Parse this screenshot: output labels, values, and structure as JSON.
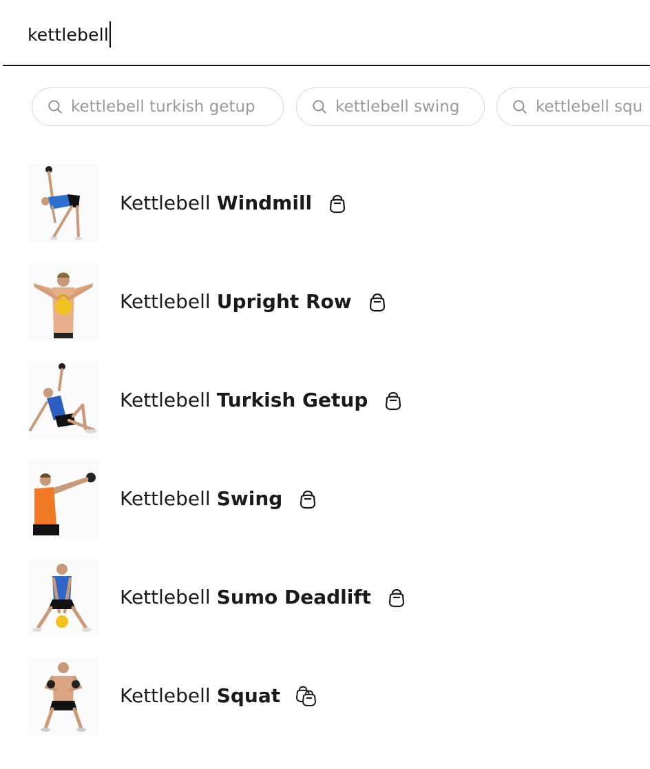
{
  "search": {
    "query": "kettlebell"
  },
  "suggestions": [
    {
      "label": "kettlebell turkish getup",
      "icon": "search-icon"
    },
    {
      "label": "kettlebell swing",
      "icon": "search-icon"
    },
    {
      "label": "kettlebell squ",
      "icon": "search-icon"
    }
  ],
  "results": [
    {
      "prefix": "Kettlebell",
      "name": "Windmill",
      "icon": "kettlebell-icon",
      "shirt_color": "#2f6fd0"
    },
    {
      "prefix": "Kettlebell",
      "name": "Upright Row",
      "icon": "kettlebell-icon",
      "shirt_color": "#e8b08a"
    },
    {
      "prefix": "Kettlebell",
      "name": "Turkish Getup",
      "icon": "kettlebell-icon",
      "shirt_color": "#2a5ec0"
    },
    {
      "prefix": "Kettlebell",
      "name": "Swing",
      "icon": "kettlebell-icon",
      "shirt_color": "#f07a25"
    },
    {
      "prefix": "Kettlebell",
      "name": "Sumo Deadlift",
      "icon": "kettlebell-icon",
      "shirt_color": "#2f66c8"
    },
    {
      "prefix": "Kettlebell",
      "name": "Squat",
      "icon": "double-kettlebell-icon",
      "shirt_color": "#d9a583"
    }
  ],
  "colors": {
    "text": "#1a1a1a",
    "chip_text": "#9a9a9a",
    "chip_border": "#d6d6d6",
    "divider": "#111111"
  }
}
